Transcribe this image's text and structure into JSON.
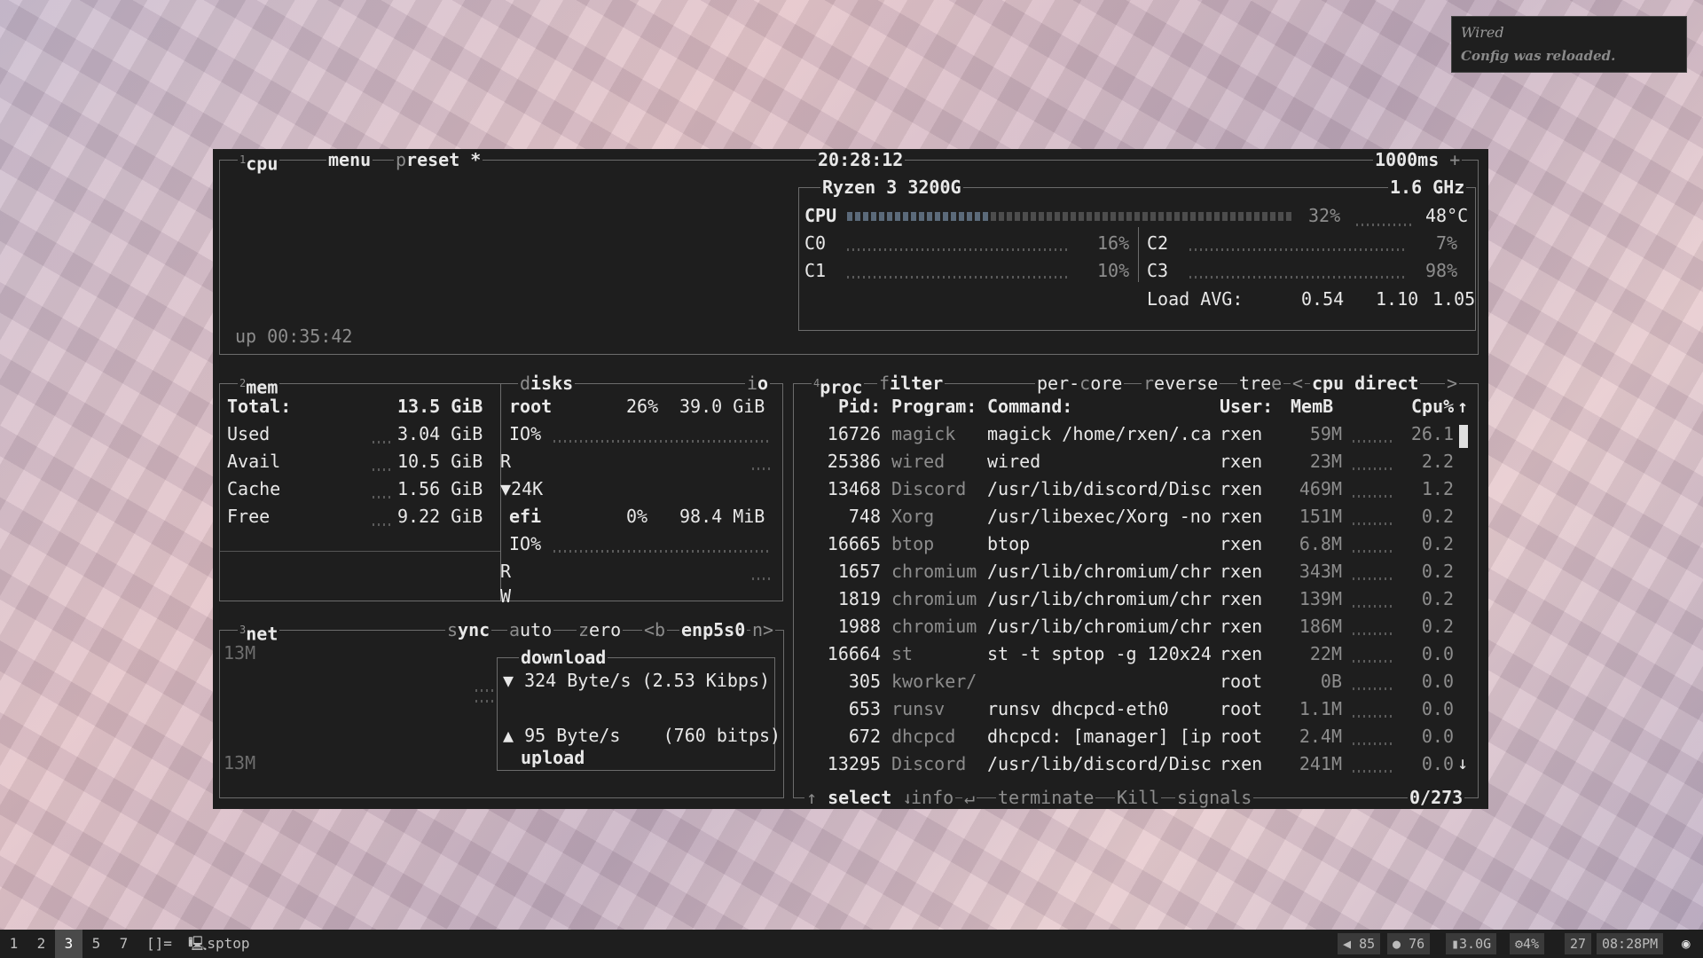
{
  "notification": {
    "title": "Wired",
    "body": "Config was reloaded."
  },
  "cpu": {
    "label": "cpu",
    "menu": "menu",
    "preset": "reset *",
    "preset_key": "p",
    "menu_key": "m",
    "time": "20:28:12",
    "interval": "1000ms",
    "uptime": "up 00:35:42",
    "model": "Ryzen 3 3200G",
    "freq": "1.6 GHz",
    "total_label": "CPU",
    "total_pct": "32%",
    "total_fill": 0.32,
    "temp": "48°C",
    "cores": [
      {
        "name": "C0",
        "pct": "16%"
      },
      {
        "name": "C1",
        "pct": "10%"
      },
      {
        "name": "C2",
        "pct": "7%"
      },
      {
        "name": "C3",
        "pct": "98%"
      }
    ],
    "load_label": "Load AVG:",
    "load": [
      "0.54",
      "1.10",
      "1.05"
    ]
  },
  "mem": {
    "label": "mem",
    "rows": [
      {
        "k": "Total:",
        "v": "13.5 GiB"
      },
      {
        "k": "Used",
        "v": "3.04 GiB"
      },
      {
        "k": "Avail",
        "v": "10.5 GiB"
      },
      {
        "k": "Cache",
        "v": "1.56 GiB"
      },
      {
        "k": "Free",
        "v": "9.22 GiB"
      }
    ]
  },
  "disks": {
    "label": "isks",
    "label_key": "d",
    "io": "o",
    "io_key": "i",
    "root": {
      "name": "root",
      "pct": "26%",
      "size": "39.0 GiB",
      "io": "IO%",
      "r": "R",
      "speed": "▼24K"
    },
    "efi": {
      "name": "efi",
      "pct": "0%",
      "size": "98.4 MiB",
      "io": "IO%",
      "r": "R",
      "w": "W"
    }
  },
  "net": {
    "label": "net",
    "sync": "ync",
    "sync_key": "s",
    "auto": "uto",
    "auto_key": "a",
    "zero": "ero",
    "zero_key": "z",
    "prev": "<b",
    "iface": "enp5s0",
    "next": "n>",
    "scale_top": "13M",
    "scale_bottom": "13M",
    "download": "download",
    "down_rate": "▼ 324 Byte/s (2.53 Kibps)",
    "up_rate": "▲ 95 Byte/s    (760 bitps)",
    "upload": "upload"
  },
  "proc": {
    "label": "proc",
    "filter": "ilter",
    "filter_key": "f",
    "percore": "per-",
    "percore_key": "c",
    "percore2": "ore",
    "reverse": "everse",
    "reverse_key": "r",
    "tree": "tre",
    "tree_key": "e",
    "sort": "cpu direct",
    "sort_prev": "<",
    "sort_next": ">",
    "headers": {
      "pid": "Pid:",
      "program": "Program:",
      "command": "Command:",
      "user": "User:",
      "mem": "MemB",
      "cpu": "Cpu%"
    },
    "rows": [
      {
        "pid": "16726",
        "program": "magick",
        "command": "magick /home/rxen/.ca",
        "user": "rxen",
        "mem": "59M",
        "cpu": "26.1"
      },
      {
        "pid": "25386",
        "program": "wired",
        "command": "wired",
        "user": "rxen",
        "mem": "23M",
        "cpu": "2.2"
      },
      {
        "pid": "13468",
        "program": "Discord",
        "command": "/usr/lib/discord/Disc",
        "user": "rxen",
        "mem": "469M",
        "cpu": "1.2"
      },
      {
        "pid": "748",
        "program": "Xorg",
        "command": "/usr/libexec/Xorg -no",
        "user": "rxen",
        "mem": "151M",
        "cpu": "0.2"
      },
      {
        "pid": "16665",
        "program": "btop",
        "command": "btop",
        "user": "rxen",
        "mem": "6.8M",
        "cpu": "0.2"
      },
      {
        "pid": "1657",
        "program": "chromium",
        "command": "/usr/lib/chromium/chr",
        "user": "rxen",
        "mem": "343M",
        "cpu": "0.2"
      },
      {
        "pid": "1819",
        "program": "chromium",
        "command": "/usr/lib/chromium/chr",
        "user": "rxen",
        "mem": "139M",
        "cpu": "0.2"
      },
      {
        "pid": "1988",
        "program": "chromium",
        "command": "/usr/lib/chromium/chr",
        "user": "rxen",
        "mem": "186M",
        "cpu": "0.2"
      },
      {
        "pid": "16664",
        "program": "st",
        "command": "st -t sptop -g 120x24",
        "user": "rxen",
        "mem": "22M",
        "cpu": "0.0"
      },
      {
        "pid": "305",
        "program": "kworker/",
        "command": "",
        "user": "root",
        "mem": "0B",
        "cpu": "0.0"
      },
      {
        "pid": "653",
        "program": "runsv",
        "command": "runsv dhcpcd-eth0",
        "user": "root",
        "mem": "1.1M",
        "cpu": "0.0"
      },
      {
        "pid": "672",
        "program": "dhcpcd",
        "command": "dhcpcd: [manager] [ip",
        "user": "root",
        "mem": "2.4M",
        "cpu": "0.0"
      },
      {
        "pid": "13295",
        "program": "Discord",
        "command": "/usr/lib/discord/Disc",
        "user": "rxen",
        "mem": "241M",
        "cpu": "0.0"
      }
    ],
    "footer": {
      "select": "select",
      "info": "info",
      "terminate": "terminate",
      "kill": "Kill",
      "signals": "signals",
      "count": "0/273"
    }
  },
  "taskbar": {
    "workspaces": [
      "1",
      "2",
      "3",
      "5",
      "7"
    ],
    "active": "3",
    "layout": "[]=",
    "title": "sptop",
    "volume": "85",
    "mic": "76",
    "mem": "3.0G",
    "cpu": "4%",
    "day": "27",
    "time": "08:28PM"
  }
}
